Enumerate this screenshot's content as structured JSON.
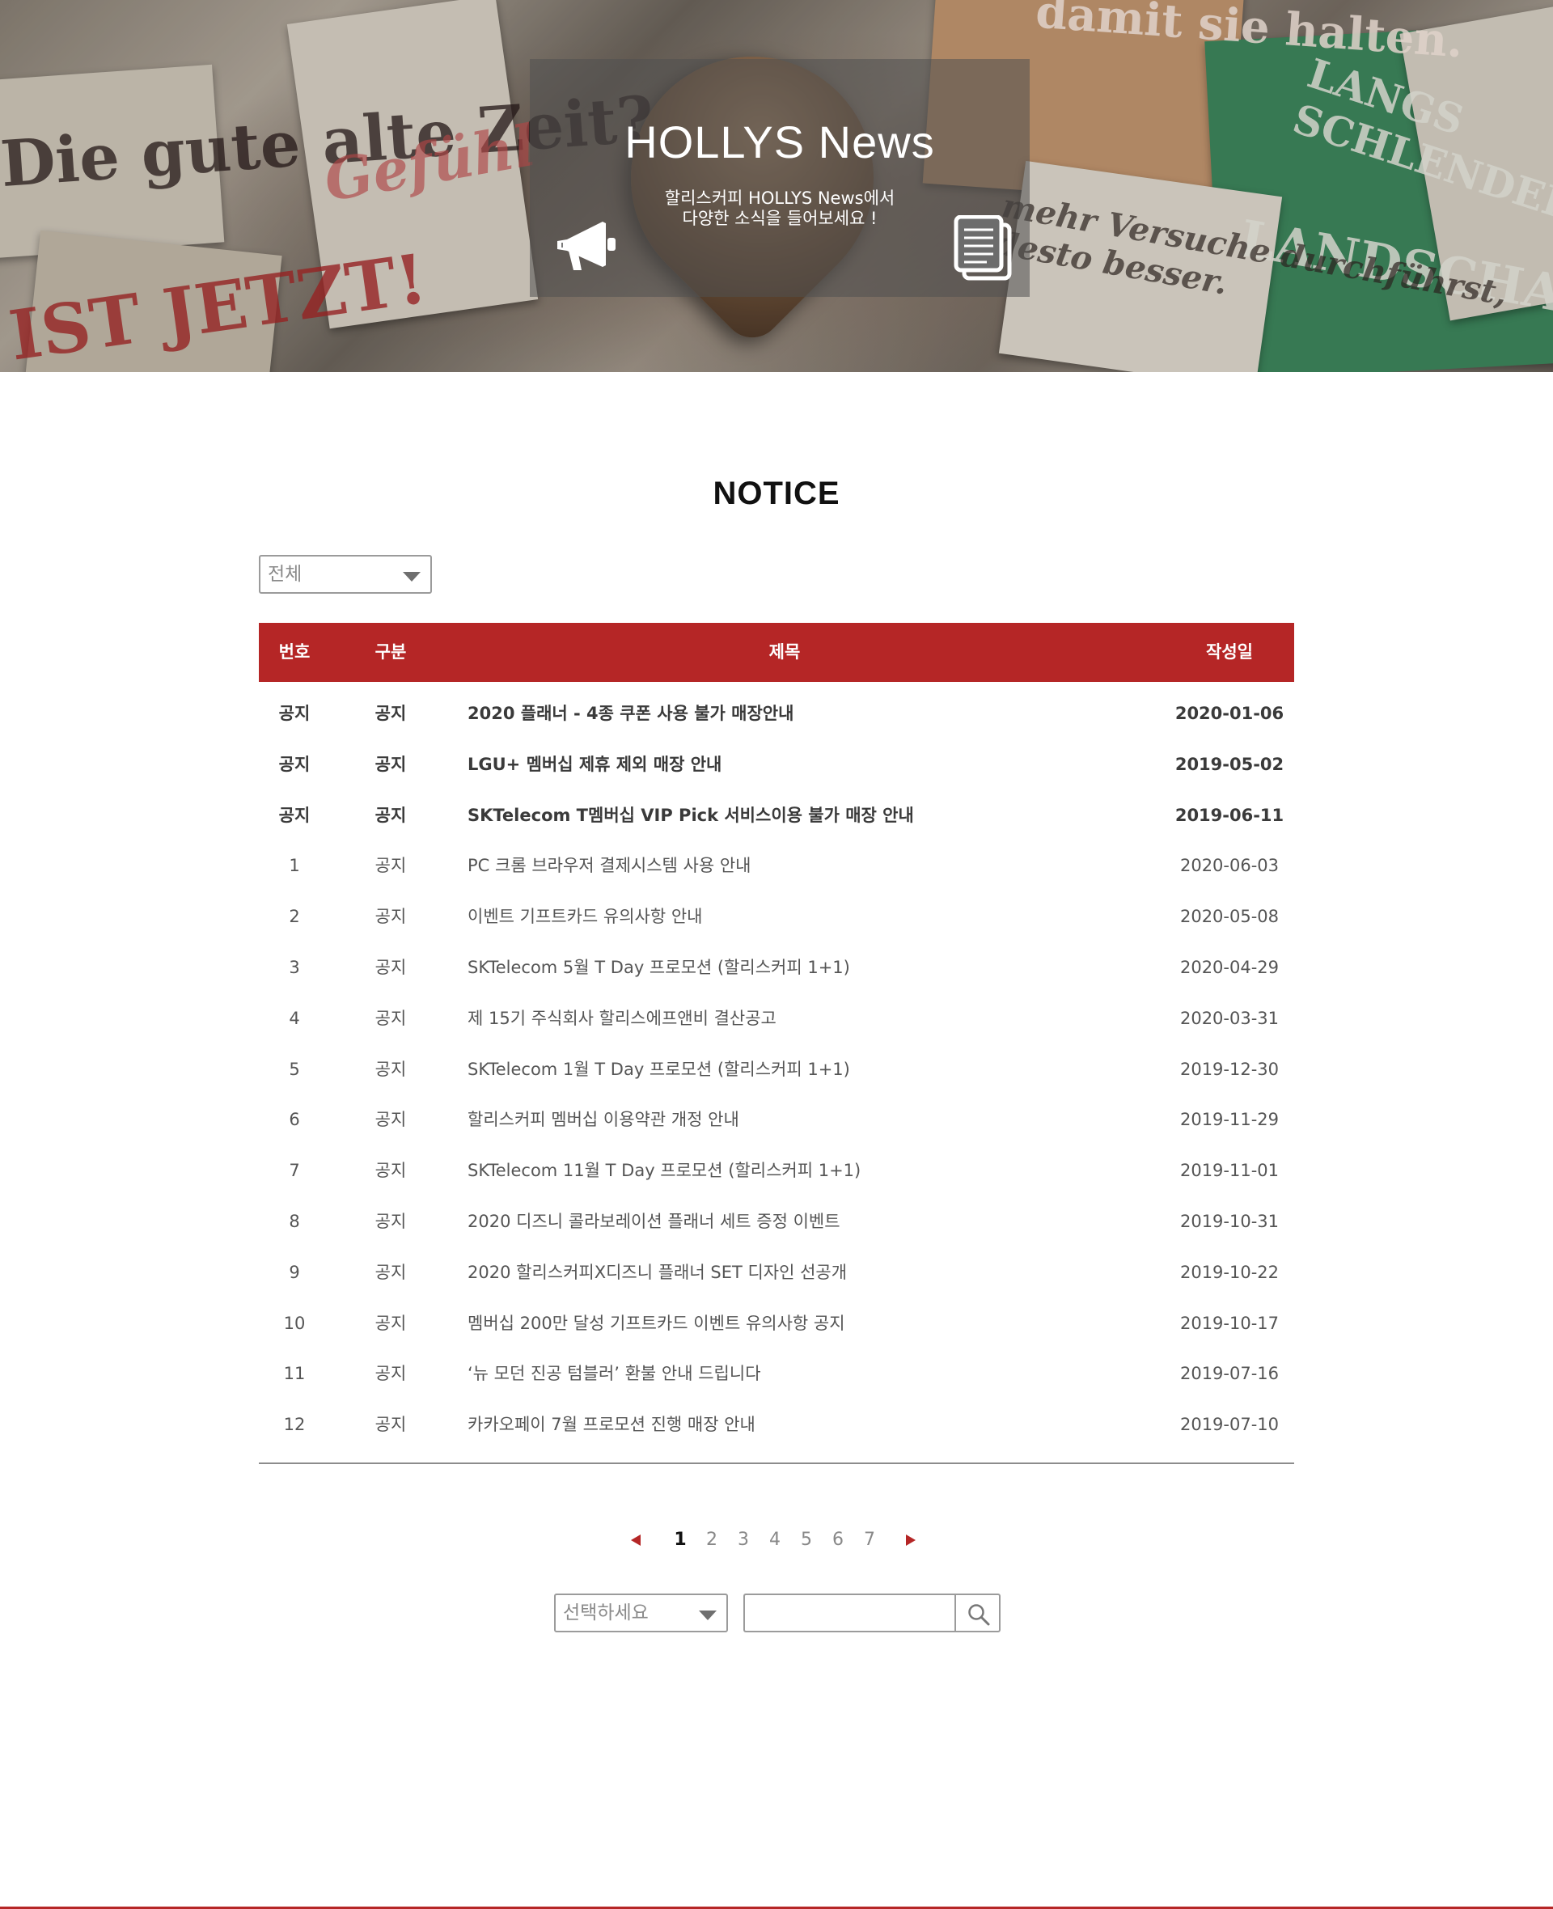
{
  "hero": {
    "title": "HOLLYS News",
    "subtitle_line1": "할리스커피 HOLLYS News에서",
    "subtitle_line2": "다양한 소식을 들어보세요 !",
    "left_icon": "megaphone-icon",
    "right_icon": "document-icon",
    "background_texts": [
      "Die gute alte Zeit?",
      "IST JETZT!",
      "LANGS SCHLENDERT",
      "LANDSCHAFT",
      "damit sie halten.",
      "Gefühl",
      "mehr Versuche durchführst, desto besser."
    ]
  },
  "notice": {
    "title": "NOTICE",
    "filter": {
      "selected": "전체"
    },
    "columns": {
      "num": "번호",
      "category": "구분",
      "title": "제목",
      "date": "작성일"
    },
    "rows": [
      {
        "num": "공지",
        "category": "공지",
        "title": "2020 플래너 - 4종 쿠폰 사용 불가 매장안내",
        "date": "2020-01-06",
        "pinned": true
      },
      {
        "num": "공지",
        "category": "공지",
        "title": "LGU+ 멤버십 제휴 제외 매장 안내",
        "date": "2019-05-02",
        "pinned": true
      },
      {
        "num": "공지",
        "category": "공지",
        "title": "SKTelecom T멤버십 VIP Pick 서비스이용 불가 매장 안내",
        "date": "2019-06-11",
        "pinned": true
      },
      {
        "num": "1",
        "category": "공지",
        "title": "PC 크롬 브라우저 결제시스템 사용 안내",
        "date": "2020-06-03",
        "pinned": false
      },
      {
        "num": "2",
        "category": "공지",
        "title": "이벤트 기프트카드 유의사항 안내",
        "date": "2020-05-08",
        "pinned": false
      },
      {
        "num": "3",
        "category": "공지",
        "title": "SKTelecom 5월 T Day 프로모션 (할리스커피 1+1)",
        "date": "2020-04-29",
        "pinned": false
      },
      {
        "num": "4",
        "category": "공지",
        "title": "제 15기 주식회사 할리스에프앤비 결산공고",
        "date": "2020-03-31",
        "pinned": false
      },
      {
        "num": "5",
        "category": "공지",
        "title": "SKTelecom 1월 T Day 프로모션 (할리스커피 1+1)",
        "date": "2019-12-30",
        "pinned": false
      },
      {
        "num": "6",
        "category": "공지",
        "title": "할리스커피 멤버십 이용약관 개정 안내",
        "date": "2019-11-29",
        "pinned": false
      },
      {
        "num": "7",
        "category": "공지",
        "title": "SKTelecom 11월 T Day 프로모션 (할리스커피 1+1)",
        "date": "2019-11-01",
        "pinned": false
      },
      {
        "num": "8",
        "category": "공지",
        "title": "2020 디즈니 콜라보레이션 플래너 세트 증정 이벤트",
        "date": "2019-10-31",
        "pinned": false
      },
      {
        "num": "9",
        "category": "공지",
        "title": "2020 할리스커피X디즈니 플래너 SET 디자인 선공개",
        "date": "2019-10-22",
        "pinned": false
      },
      {
        "num": "10",
        "category": "공지",
        "title": "멤버십 200만 달성 기프트카드 이벤트 유의사항 공지",
        "date": "2019-10-17",
        "pinned": false
      },
      {
        "num": "11",
        "category": "공지",
        "title": "‘뉴 모던 진공 텀블러’ 환불 안내 드립니다",
        "date": "2019-07-16",
        "pinned": false
      },
      {
        "num": "12",
        "category": "공지",
        "title": "카카오페이 7월 프로모션 진행 매장 안내",
        "date": "2019-07-10",
        "pinned": false
      }
    ]
  },
  "pagination": {
    "pages": [
      "1",
      "2",
      "3",
      "4",
      "5",
      "6",
      "7"
    ],
    "current": "1",
    "prev_icon": "triangle-left-icon",
    "next_icon": "triangle-right-icon"
  },
  "search": {
    "select_placeholder": "선택하세요",
    "input_value": "",
    "button_icon": "magnifier-icon"
  },
  "colors": {
    "accent": "#b52626",
    "header_text": "#ffffff",
    "body_text": "#555555",
    "overlay": "rgba(80,80,80,0.55)"
  }
}
